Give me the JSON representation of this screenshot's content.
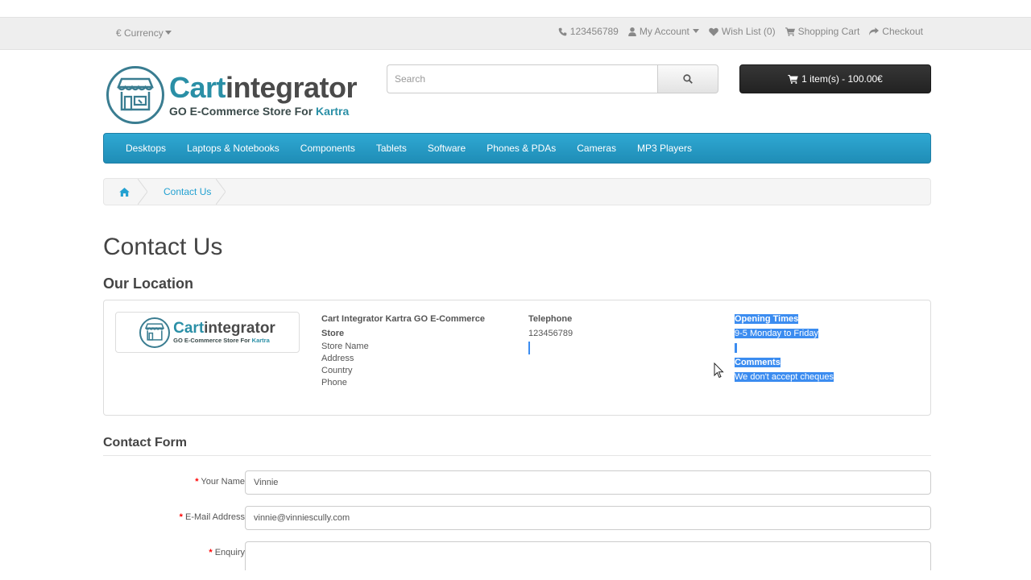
{
  "header": {
    "currency_label": "€ Currency",
    "phone": "123456789",
    "my_account": "My Account",
    "wish_list": "Wish List (0)",
    "shopping_cart": "Shopping Cart",
    "checkout": "Checkout"
  },
  "logo": {
    "name_part1": "Cart",
    "name_part2": "integrator",
    "tagline_part1": "GO E-Commerce Store For ",
    "tagline_part2": "Kartra"
  },
  "search": {
    "placeholder": "Search"
  },
  "cart": {
    "label": "1 item(s) - 100.00€"
  },
  "menu": [
    "Desktops",
    "Laptops & Notebooks",
    "Components",
    "Tablets",
    "Software",
    "Phones & PDAs",
    "Cameras",
    "MP3 Players"
  ],
  "breadcrumb": {
    "current": "Contact Us"
  },
  "page": {
    "title": "Contact Us",
    "location_heading": "Our Location"
  },
  "location": {
    "store_name_bold": "Cart Integrator Kartra GO E-Commerce Store",
    "lines": [
      "Store Name",
      "Address",
      "Country",
      "Phone"
    ],
    "telephone_heading": "Telephone",
    "telephone": "123456789",
    "opening_heading": "Opening Times",
    "opening": "9-5 Monday to Friday",
    "comments_heading": "Comments",
    "comments": "We don't accept cheques"
  },
  "form": {
    "heading": "Contact Form",
    "name_label": "Your Name",
    "name_value": "Vinnie",
    "email_label": "E-Mail Address",
    "email_value": "vinnie@vinniescully.com",
    "enquiry_label": "Enquiry",
    "required_mark": "*"
  },
  "colors": {
    "accent": "#23a1d1",
    "menu": "#2fa8d3",
    "selection": "#3b8cf0"
  }
}
